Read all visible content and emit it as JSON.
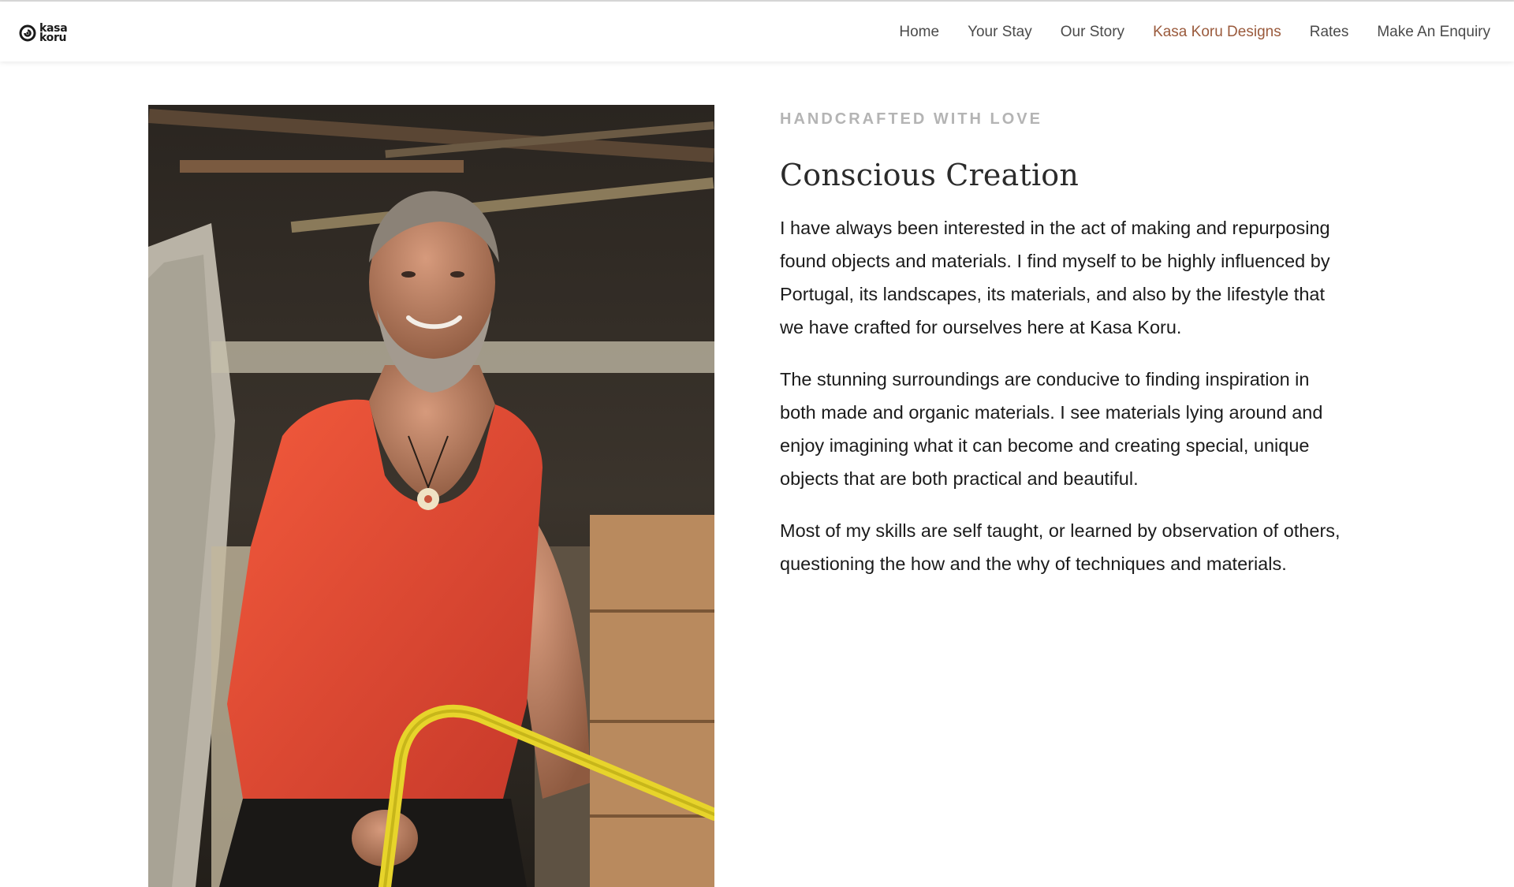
{
  "brand": {
    "logo_line1": "kasa",
    "logo_line2": "koru"
  },
  "nav": {
    "items": [
      {
        "label": "Home"
      },
      {
        "label": "Your Stay"
      },
      {
        "label": "Our Story"
      },
      {
        "label": "Kasa Koru Designs",
        "active": true
      },
      {
        "label": "Rates"
      },
      {
        "label": "Make An Enquiry"
      }
    ],
    "active_color": "#9a5a3c"
  },
  "hero_image": {
    "subject": "portrait-of-craftsman-in-workshop"
  },
  "section": {
    "eyebrow": "HANDCRAFTED WITH LOVE",
    "title": "Conscious Creation",
    "paragraphs": [
      "I have always been interested in the act of making and repurposing found objects and materials. I find myself to be highly influenced by Portugal, its landscapes, its materials, and also by the lifestyle that we have crafted for ourselves here at Kasa Koru.",
      "The stunning surroundings are conducive to finding inspiration in both made and organic materials. I see materials lying around and enjoy imagining what it can become and creating special, unique objects that are both practical and beautiful.",
      "Most of my skills are self taught, or learned by observation of others, questioning the how and the why of techniques and materials."
    ]
  }
}
